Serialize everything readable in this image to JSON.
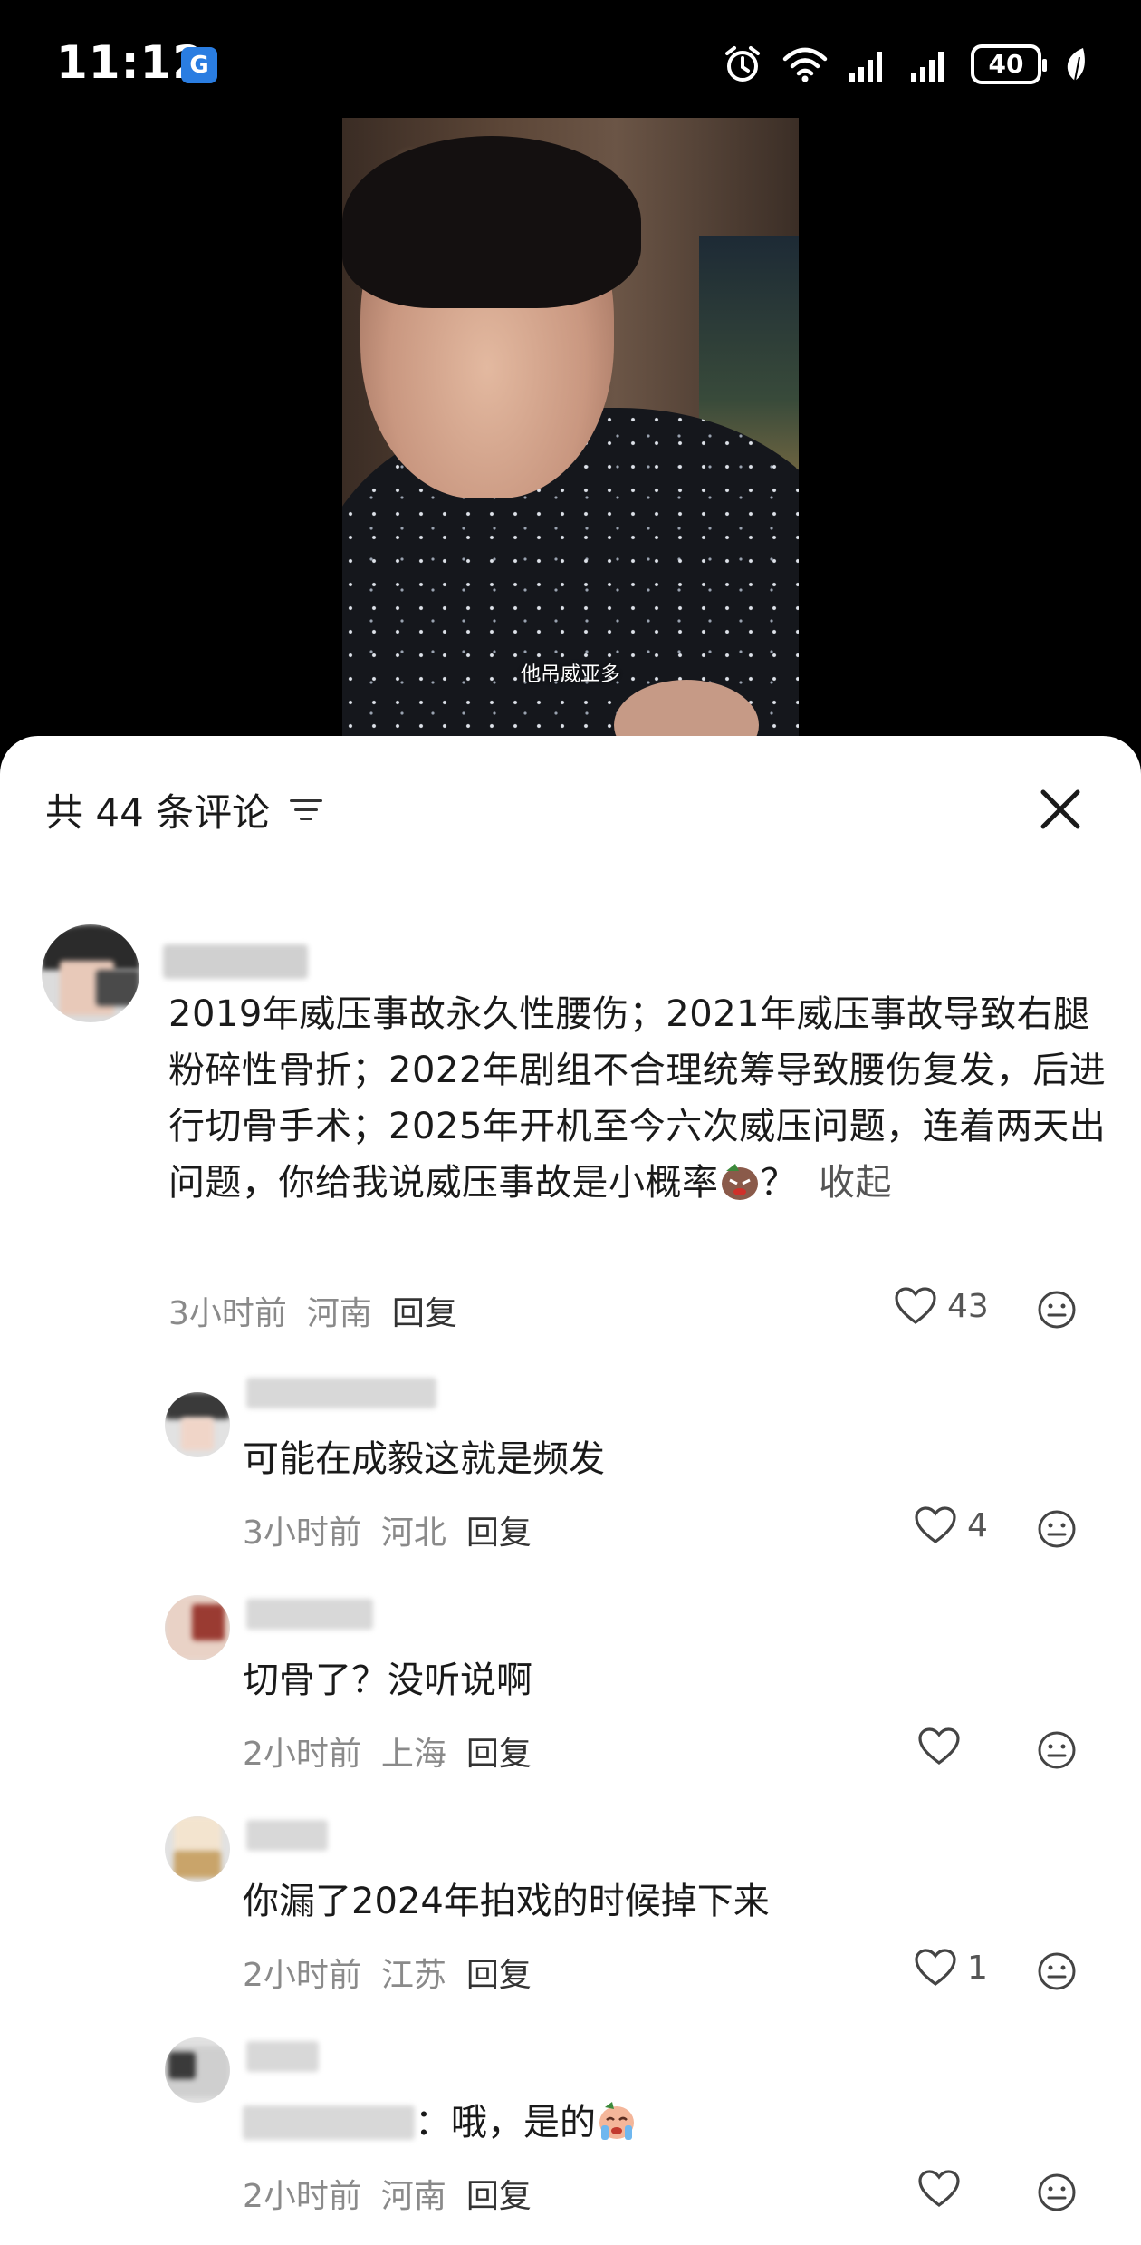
{
  "status_bar": {
    "time": "11:12",
    "app_badge": "G",
    "battery": "40",
    "icons": [
      "alarm-icon",
      "wifi-icon",
      "signal-icon",
      "signal-icon",
      "battery-icon",
      "leaf-icon"
    ]
  },
  "video": {
    "subtitle": "他吊威亚多"
  },
  "comments_panel": {
    "title": "共 44 条评论",
    "sort_icon": "sort-icon",
    "close_icon": "close-icon"
  },
  "comments": [
    {
      "text": "2019年威压事故永久性腰伤；2021年威压事故导致右腿粉碎性骨折；2022年剧组不合理统筹导致腰伤复发，后进行切骨手术；2025年开机至今六次威压问题，连着两天出问题，你给我说威压事故是小概率",
      "tail": "？",
      "collapse": "收起",
      "time": "3小时前",
      "location": "河南",
      "reply": "回复",
      "likes": "43"
    },
    {
      "text": "可能在成毅这就是频发",
      "time": "3小时前",
      "location": "河北",
      "reply": "回复",
      "likes": "4"
    },
    {
      "text": "切骨了？没听说啊",
      "time": "2小时前",
      "location": "上海",
      "reply": "回复",
      "likes": ""
    },
    {
      "text": "你漏了2024年拍戏的时候掉下来",
      "time": "2小时前",
      "location": "江苏",
      "reply": "回复",
      "likes": "1"
    },
    {
      "text": "：哦，是的",
      "time": "2小时前",
      "location": "河南",
      "reply": "回复",
      "likes": ""
    }
  ],
  "colors": {
    "sheet_bg": "#ffffff",
    "text_primary": "#1a1a1a",
    "text_meta": "#8a8a8a"
  }
}
